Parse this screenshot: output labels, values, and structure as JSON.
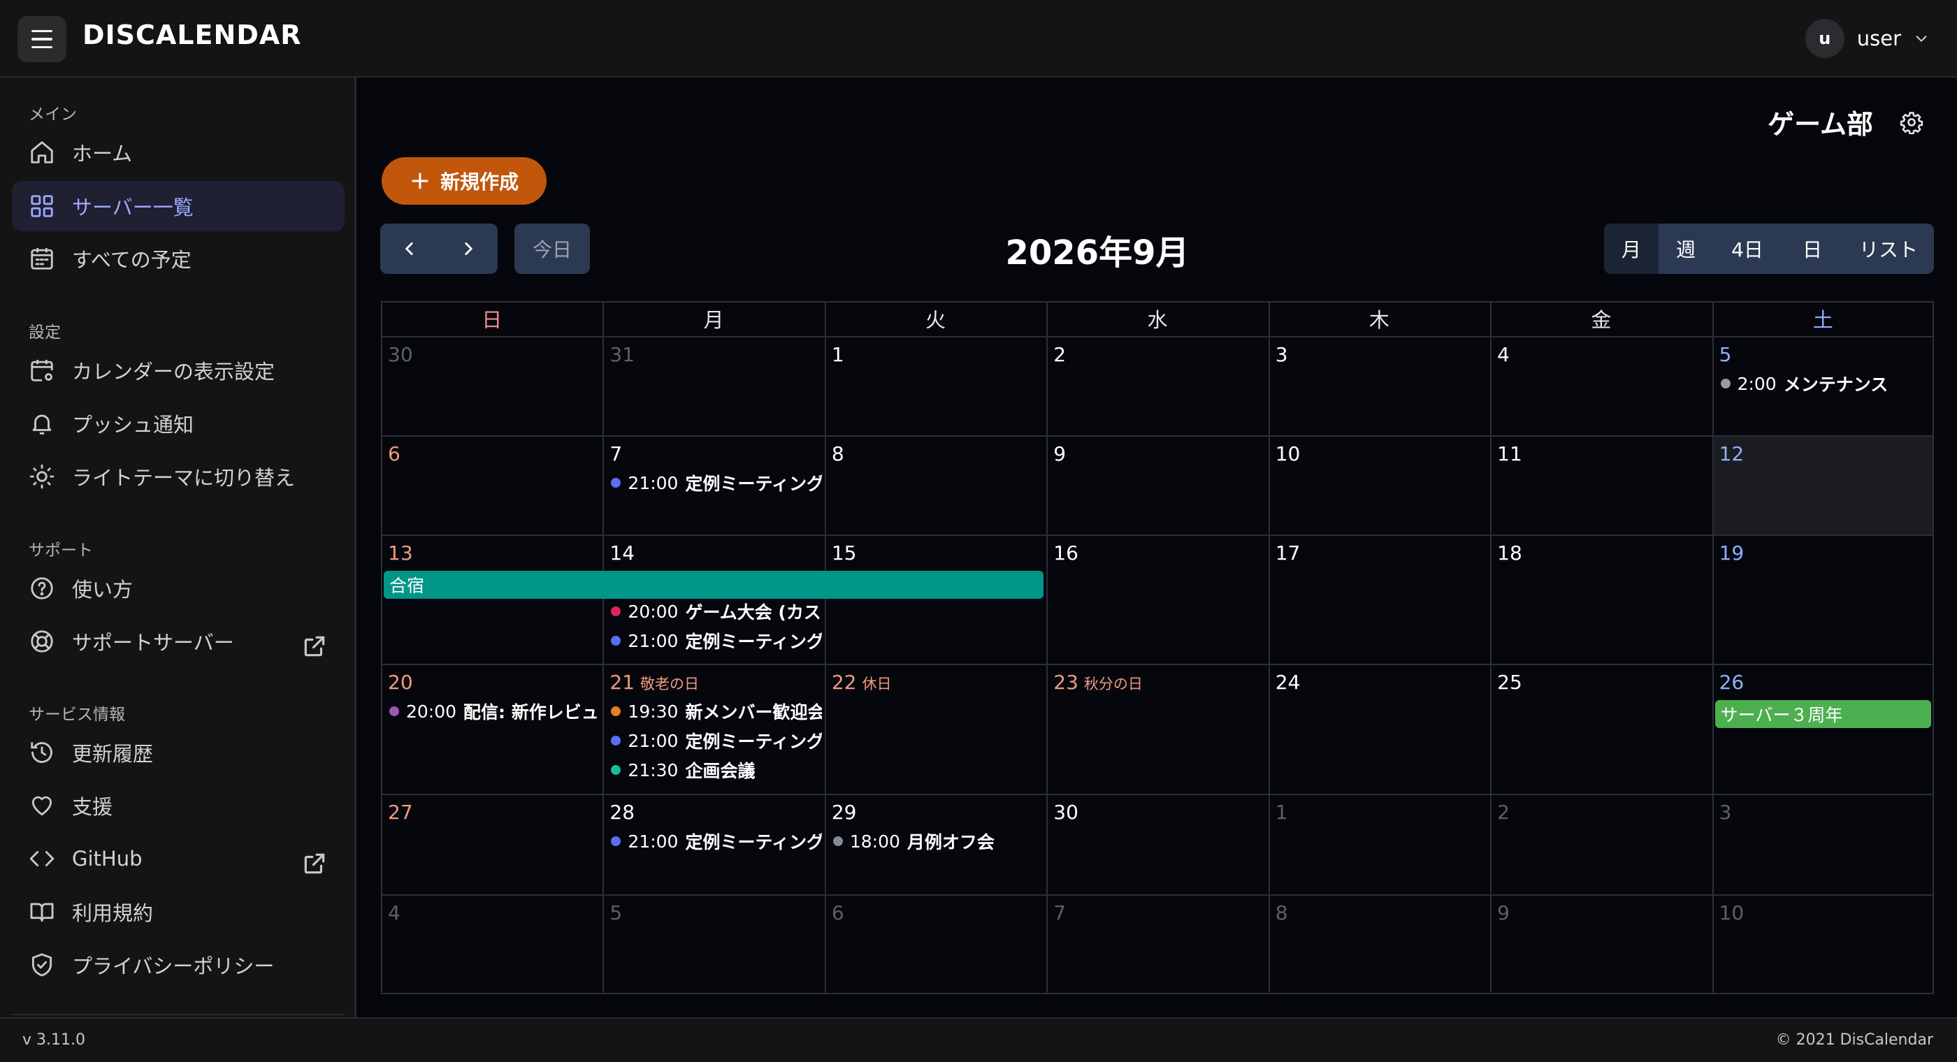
{
  "app": {
    "title": "DISCALENDAR"
  },
  "user": {
    "initial": "u",
    "name": "user"
  },
  "sidebar": {
    "sections": [
      {
        "title": "メイン",
        "items": [
          {
            "label": "ホーム",
            "icon": "home-icon"
          },
          {
            "label": "サーバー一覧",
            "icon": "grid-icon",
            "active": true
          },
          {
            "label": "すべての予定",
            "icon": "calendar-icon"
          }
        ]
      },
      {
        "title": "設定",
        "items": [
          {
            "label": "カレンダーの表示設定",
            "icon": "calendar-settings-icon"
          },
          {
            "label": "プッシュ通知",
            "icon": "bell-icon"
          },
          {
            "label": "ライトテーマに切り替え",
            "icon": "sun-icon"
          }
        ]
      },
      {
        "title": "サポート",
        "items": [
          {
            "label": "使い方",
            "icon": "help-icon"
          },
          {
            "label": "サポートサーバー",
            "icon": "lifebuoy-icon",
            "external": true
          }
        ]
      },
      {
        "title": "サービス情報",
        "items": [
          {
            "label": "更新履歴",
            "icon": "history-icon"
          },
          {
            "label": "支援",
            "icon": "heart-icon"
          },
          {
            "label": "GitHub",
            "icon": "code-icon",
            "external": true
          },
          {
            "label": "利用規約",
            "icon": "book-icon"
          },
          {
            "label": "プライバシーポリシー",
            "icon": "shield-icon"
          }
        ]
      }
    ]
  },
  "footer": {
    "version": "v 3.11.0",
    "copyright": "© 2021 DisCalendar"
  },
  "main": {
    "server_name": "ゲーム部",
    "new_button": "新規作成",
    "today_button": "今日",
    "month_title": "2026年9月",
    "views": [
      "月",
      "週",
      "4日",
      "日",
      "リスト"
    ],
    "active_view": "月"
  },
  "colors": {
    "accent": "#c2570c",
    "event_blue": "#5b6ef5",
    "event_pink": "#e0245e",
    "event_purple": "#9b59b6",
    "event_orange": "#e67e22",
    "event_cyan": "#1abc9c",
    "event_gray": "#9a9aa0",
    "event_slate": "#7f8c9a",
    "bar_teal": "#009688",
    "bar_green": "#4caf50"
  },
  "calendar": {
    "weekdays": [
      "日",
      "月",
      "火",
      "水",
      "木",
      "金",
      "土"
    ],
    "weeks": [
      [
        {
          "d": "30",
          "other": true
        },
        {
          "d": "31",
          "other": true
        },
        {
          "d": "1"
        },
        {
          "d": "2"
        },
        {
          "d": "3"
        },
        {
          "d": "4"
        },
        {
          "d": "5"
        }
      ],
      [
        {
          "d": "6"
        },
        {
          "d": "7"
        },
        {
          "d": "8"
        },
        {
          "d": "9"
        },
        {
          "d": "10"
        },
        {
          "d": "11"
        },
        {
          "d": "12",
          "today": true
        }
      ],
      [
        {
          "d": "13"
        },
        {
          "d": "14"
        },
        {
          "d": "15"
        },
        {
          "d": "16"
        },
        {
          "d": "17"
        },
        {
          "d": "18"
        },
        {
          "d": "19"
        }
      ],
      [
        {
          "d": "20"
        },
        {
          "d": "21",
          "holiday": "敬老の日"
        },
        {
          "d": "22",
          "holiday": "休日"
        },
        {
          "d": "23",
          "holiday": "秋分の日"
        },
        {
          "d": "24"
        },
        {
          "d": "25"
        },
        {
          "d": "26"
        }
      ],
      [
        {
          "d": "27"
        },
        {
          "d": "28"
        },
        {
          "d": "29"
        },
        {
          "d": "30"
        },
        {
          "d": "1",
          "other": true
        },
        {
          "d": "2",
          "other": true
        },
        {
          "d": "3",
          "other": true
        }
      ],
      [
        {
          "d": "4",
          "other": true
        },
        {
          "d": "5",
          "other": true
        },
        {
          "d": "6",
          "other": true
        },
        {
          "d": "7",
          "other": true
        },
        {
          "d": "8",
          "other": true
        },
        {
          "d": "9",
          "other": true
        },
        {
          "d": "10",
          "other": true
        }
      ]
    ],
    "events": [
      {
        "week": 0,
        "day": 6,
        "slot": 0,
        "time": "2:00",
        "title": "メンテナンス",
        "color": "#9a9aa0"
      },
      {
        "week": 1,
        "day": 1,
        "slot": 0,
        "time": "21:00",
        "title": "定例ミーティング",
        "color": "#5b6ef5"
      },
      {
        "week": 2,
        "day": 1,
        "slot": 1,
        "time": "20:00",
        "title": "ゲーム大会 (カスタム)",
        "color": "#e0245e"
      },
      {
        "week": 2,
        "day": 1,
        "slot": 2,
        "time": "21:00",
        "title": "定例ミーティング",
        "color": "#5b6ef5"
      },
      {
        "week": 3,
        "day": 0,
        "slot": 0,
        "time": "20:00",
        "title": "配信: 新作レビュー",
        "color": "#9b59b6"
      },
      {
        "week": 3,
        "day": 1,
        "slot": 0,
        "time": "19:30",
        "title": "新メンバー歓迎会",
        "color": "#e67e22"
      },
      {
        "week": 3,
        "day": 1,
        "slot": 1,
        "time": "21:00",
        "title": "定例ミーティング",
        "color": "#5b6ef5"
      },
      {
        "week": 3,
        "day": 1,
        "slot": 2,
        "time": "21:30",
        "title": "企画会議",
        "color": "#1abc9c"
      },
      {
        "week": 4,
        "day": 1,
        "slot": 0,
        "time": "21:00",
        "title": "定例ミーティング",
        "color": "#5b6ef5"
      },
      {
        "week": 4,
        "day": 2,
        "slot": 0,
        "time": "18:00",
        "title": "月例オフ会",
        "color": "#7f8c9a"
      }
    ],
    "bars": [
      {
        "week": 2,
        "start": 0,
        "span": 3,
        "title": "合宿",
        "color": "#009688"
      },
      {
        "week": 3,
        "start": 6,
        "span": 1,
        "title": "サーバー３周年",
        "color": "#4caf50"
      }
    ]
  }
}
